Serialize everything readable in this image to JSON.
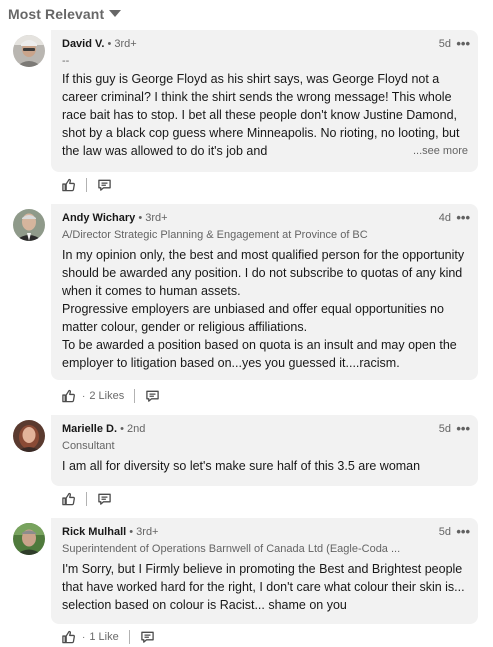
{
  "sort": {
    "label": "Most Relevant"
  },
  "comments": [
    {
      "author": "David V.",
      "degree": "• 3rd+",
      "headline": "--",
      "time": "5d",
      "more": "•••",
      "text": "If this guy is George Floyd as his shirt says, was George Floyd not a career criminal?  I think the shirt sends the wrong message!  This whole race bait has to stop.  I bet all these people don't know Justine Damond, shot by a black cop guess where Minneapolis.  No rioting, no looting, but the law was allowed to do it's job and",
      "see_more": "...see more",
      "likes": ""
    },
    {
      "author": "Andy Wichary",
      "degree": "• 3rd+",
      "headline": "A/Director Strategic Planning & Engagement at Province of BC",
      "time": "4d",
      "more": "•••",
      "paragraphs": [
        "In my opinion only, the best and most qualified person for the opportunity should be awarded any position. I do not subscribe to quotas of any kind when it comes to  human assets.",
        "Progressive employers are unbiased and offer equal opportunities no matter colour, gender or religious affiliations.",
        "To be awarded a position based on quota is an insult and may open the employer to litigation based on...yes you guessed it....racism."
      ],
      "likes": "2 Likes"
    },
    {
      "author": "Marielle D.",
      "degree": "• 2nd",
      "headline": "Consultant",
      "time": "5d",
      "more": "•••",
      "text": "I am all for diversity so let's make sure half of this 3.5 are woman",
      "likes": ""
    },
    {
      "author": "Rick Mulhall",
      "degree": "• 3rd+",
      "headline": "Superintendent of Operations Barnwell of Canada Ltd (Eagle-Coda ...",
      "time": "5d",
      "more": "•••",
      "text": "I'm Sorry, but I Firmly believe in promoting the Best and Brightest people that have worked hard for the right, I don't care what colour their skin is...  selection based on colour is Racist... shame on you",
      "likes": "1 Like"
    }
  ],
  "actions": {
    "dot": "·",
    "like_icon": "thumbs-up-icon",
    "reply_icon": "reply-icon"
  }
}
